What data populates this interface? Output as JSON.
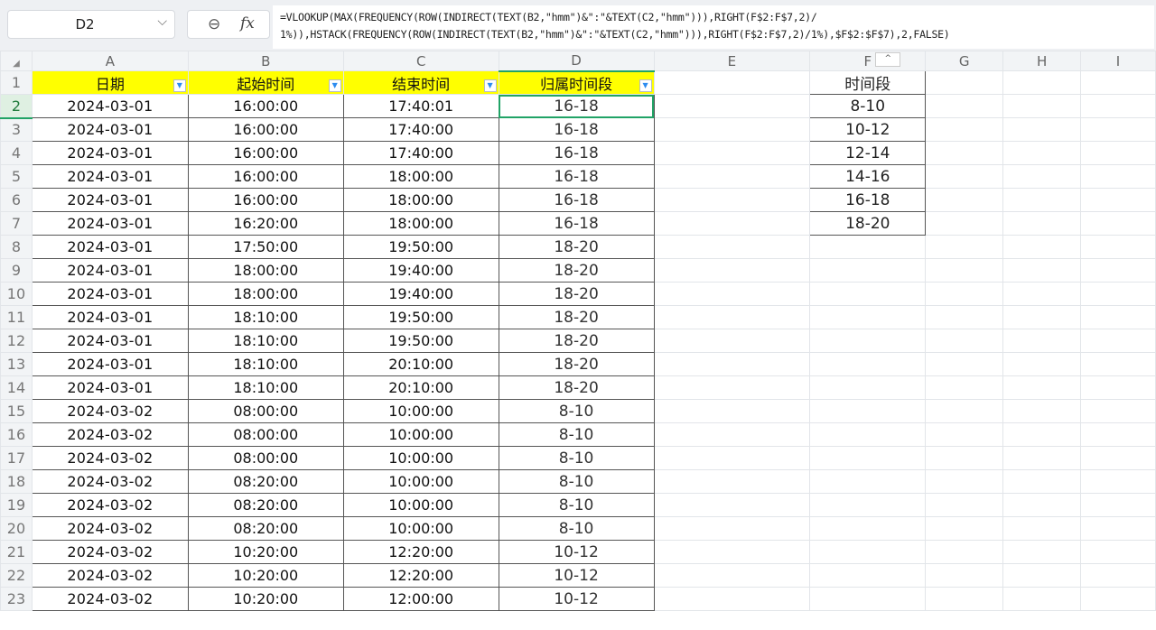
{
  "formula_bar": {
    "cell_reference": "D2",
    "zoom_icon": "zoom-icon",
    "fx_label": "fx",
    "formula_line1": "=VLOOKUP(MAX(FREQUENCY(ROW(INDIRECT(TEXT(B2,\"hmm\")&\":\"&TEXT(C2,\"hmm\"))),RIGHT(F$2:F$7,2)/",
    "formula_line2": "1%)),HSTACK(FREQUENCY(ROW(INDIRECT(TEXT(B2,\"hmm\")&\":\"&TEXT(C2,\"hmm\"))),RIGHT(F$2:F$7,2)/1%),$F$2:$F$7),2,FALSE)"
  },
  "columns": [
    "A",
    "B",
    "C",
    "D",
    "E",
    "F",
    "G",
    "H",
    "I"
  ],
  "selected_column": "D",
  "selected_row": 2,
  "header_row": {
    "A": "日期",
    "B": "起始时间",
    "C": "结束时间",
    "D": "归属时间段",
    "F": "时间段"
  },
  "rows": [
    {
      "n": 2,
      "A": "2024-03-01",
      "B": "16:00:00",
      "C": "17:40:01",
      "D": "16-18",
      "F": "8-10"
    },
    {
      "n": 3,
      "A": "2024-03-01",
      "B": "16:00:00",
      "C": "17:40:00",
      "D": "16-18",
      "F": "10-12"
    },
    {
      "n": 4,
      "A": "2024-03-01",
      "B": "16:00:00",
      "C": "17:40:00",
      "D": "16-18",
      "F": "12-14"
    },
    {
      "n": 5,
      "A": "2024-03-01",
      "B": "16:00:00",
      "C": "18:00:00",
      "D": "16-18",
      "F": "14-16"
    },
    {
      "n": 6,
      "A": "2024-03-01",
      "B": "16:00:00",
      "C": "18:00:00",
      "D": "16-18",
      "F": "16-18"
    },
    {
      "n": 7,
      "A": "2024-03-01",
      "B": "16:20:00",
      "C": "18:00:00",
      "D": "16-18",
      "F": "18-20"
    },
    {
      "n": 8,
      "A": "2024-03-01",
      "B": "17:50:00",
      "C": "19:50:00",
      "D": "18-20"
    },
    {
      "n": 9,
      "A": "2024-03-01",
      "B": "18:00:00",
      "C": "19:40:00",
      "D": "18-20"
    },
    {
      "n": 10,
      "A": "2024-03-01",
      "B": "18:00:00",
      "C": "19:40:00",
      "D": "18-20"
    },
    {
      "n": 11,
      "A": "2024-03-01",
      "B": "18:10:00",
      "C": "19:50:00",
      "D": "18-20"
    },
    {
      "n": 12,
      "A": "2024-03-01",
      "B": "18:10:00",
      "C": "19:50:00",
      "D": "18-20"
    },
    {
      "n": 13,
      "A": "2024-03-01",
      "B": "18:10:00",
      "C": "20:10:00",
      "D": "18-20"
    },
    {
      "n": 14,
      "A": "2024-03-01",
      "B": "18:10:00",
      "C": "20:10:00",
      "D": "18-20"
    },
    {
      "n": 15,
      "A": "2024-03-02",
      "B": "08:00:00",
      "C": "10:00:00",
      "D": "8-10"
    },
    {
      "n": 16,
      "A": "2024-03-02",
      "B": "08:00:00",
      "C": "10:00:00",
      "D": "8-10"
    },
    {
      "n": 17,
      "A": "2024-03-02",
      "B": "08:00:00",
      "C": "10:00:00",
      "D": "8-10"
    },
    {
      "n": 18,
      "A": "2024-03-02",
      "B": "08:20:00",
      "C": "10:00:00",
      "D": "8-10"
    },
    {
      "n": 19,
      "A": "2024-03-02",
      "B": "08:20:00",
      "C": "10:00:00",
      "D": "8-10"
    },
    {
      "n": 20,
      "A": "2024-03-02",
      "B": "08:20:00",
      "C": "10:00:00",
      "D": "8-10"
    },
    {
      "n": 21,
      "A": "2024-03-02",
      "B": "10:20:00",
      "C": "12:20:00",
      "D": "10-12"
    },
    {
      "n": 22,
      "A": "2024-03-02",
      "B": "10:20:00",
      "C": "12:20:00",
      "D": "10-12"
    },
    {
      "n": 23,
      "A": "2024-03-02",
      "B": "10:20:00",
      "C": "12:00:00",
      "D": "10-12"
    }
  ],
  "colors": {
    "header_fill": "#ffff00",
    "selection": "#21a366",
    "grid_line": "#e2e5e9"
  }
}
